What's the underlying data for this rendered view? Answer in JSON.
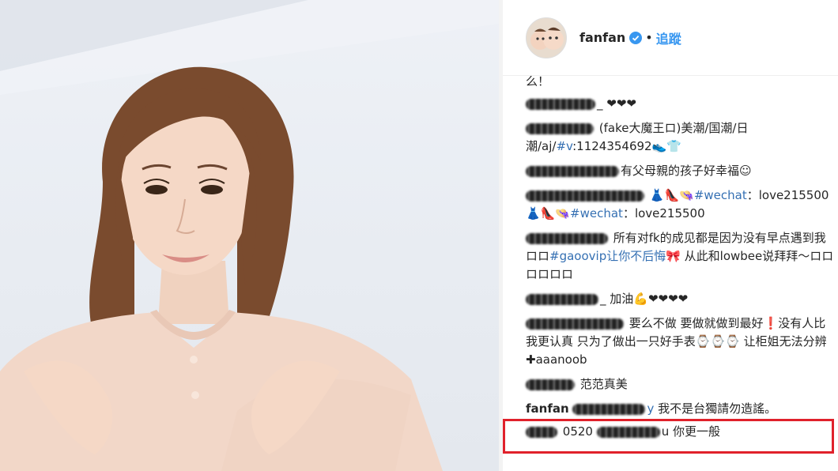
{
  "post": {
    "username": "fanfan",
    "separator": "•",
    "follow_label": "追蹤"
  },
  "icons": {
    "verified": "verified-badge-icon",
    "avatar": "avatar-icon"
  },
  "colors": {
    "link": "#3570b3",
    "follow": "#3897f0",
    "highlight_border": "#e0212b"
  },
  "comments": [
    {
      "text_head": "么！"
    },
    {
      "text": "_ ❤❤❤"
    },
    {
      "text_a": "(fake大魔王ロ)美潮/国潮/日潮/aj/",
      "tag": "#v",
      "text_b": ":1124354692👟👕"
    },
    {
      "text": "有父母親的孩子好幸福☺"
    },
    {
      "text_a": "👗👠👒",
      "tag": "#wechat",
      "text_b": "：love215500👗👠👒",
      "tag2": "#wechat",
      "text_c": "：love215500"
    },
    {
      "text_a": "所有对fk的成见都是因为没有早点遇到我ロロ",
      "tag": "#gaoovip让你不后悔",
      "text_b": "🎀 从此和lowbee说拜拜～ロロロロロロ"
    },
    {
      "text": "_ 加油💪❤❤❤❤"
    },
    {
      "text": "要么不做 要做就做到最好❗没有人比我更认真 只为了做出一只好手表⌚⌚⌚ 让柜姐无法分辨✚aaanoob"
    },
    {
      "text": "范范真美"
    },
    {
      "name": "fanfan",
      "mention_tail": "y",
      "text": "我不是台獨請勿造謠。"
    },
    {
      "text_a": "0520",
      "text_b": "u 你更一般"
    }
  ]
}
